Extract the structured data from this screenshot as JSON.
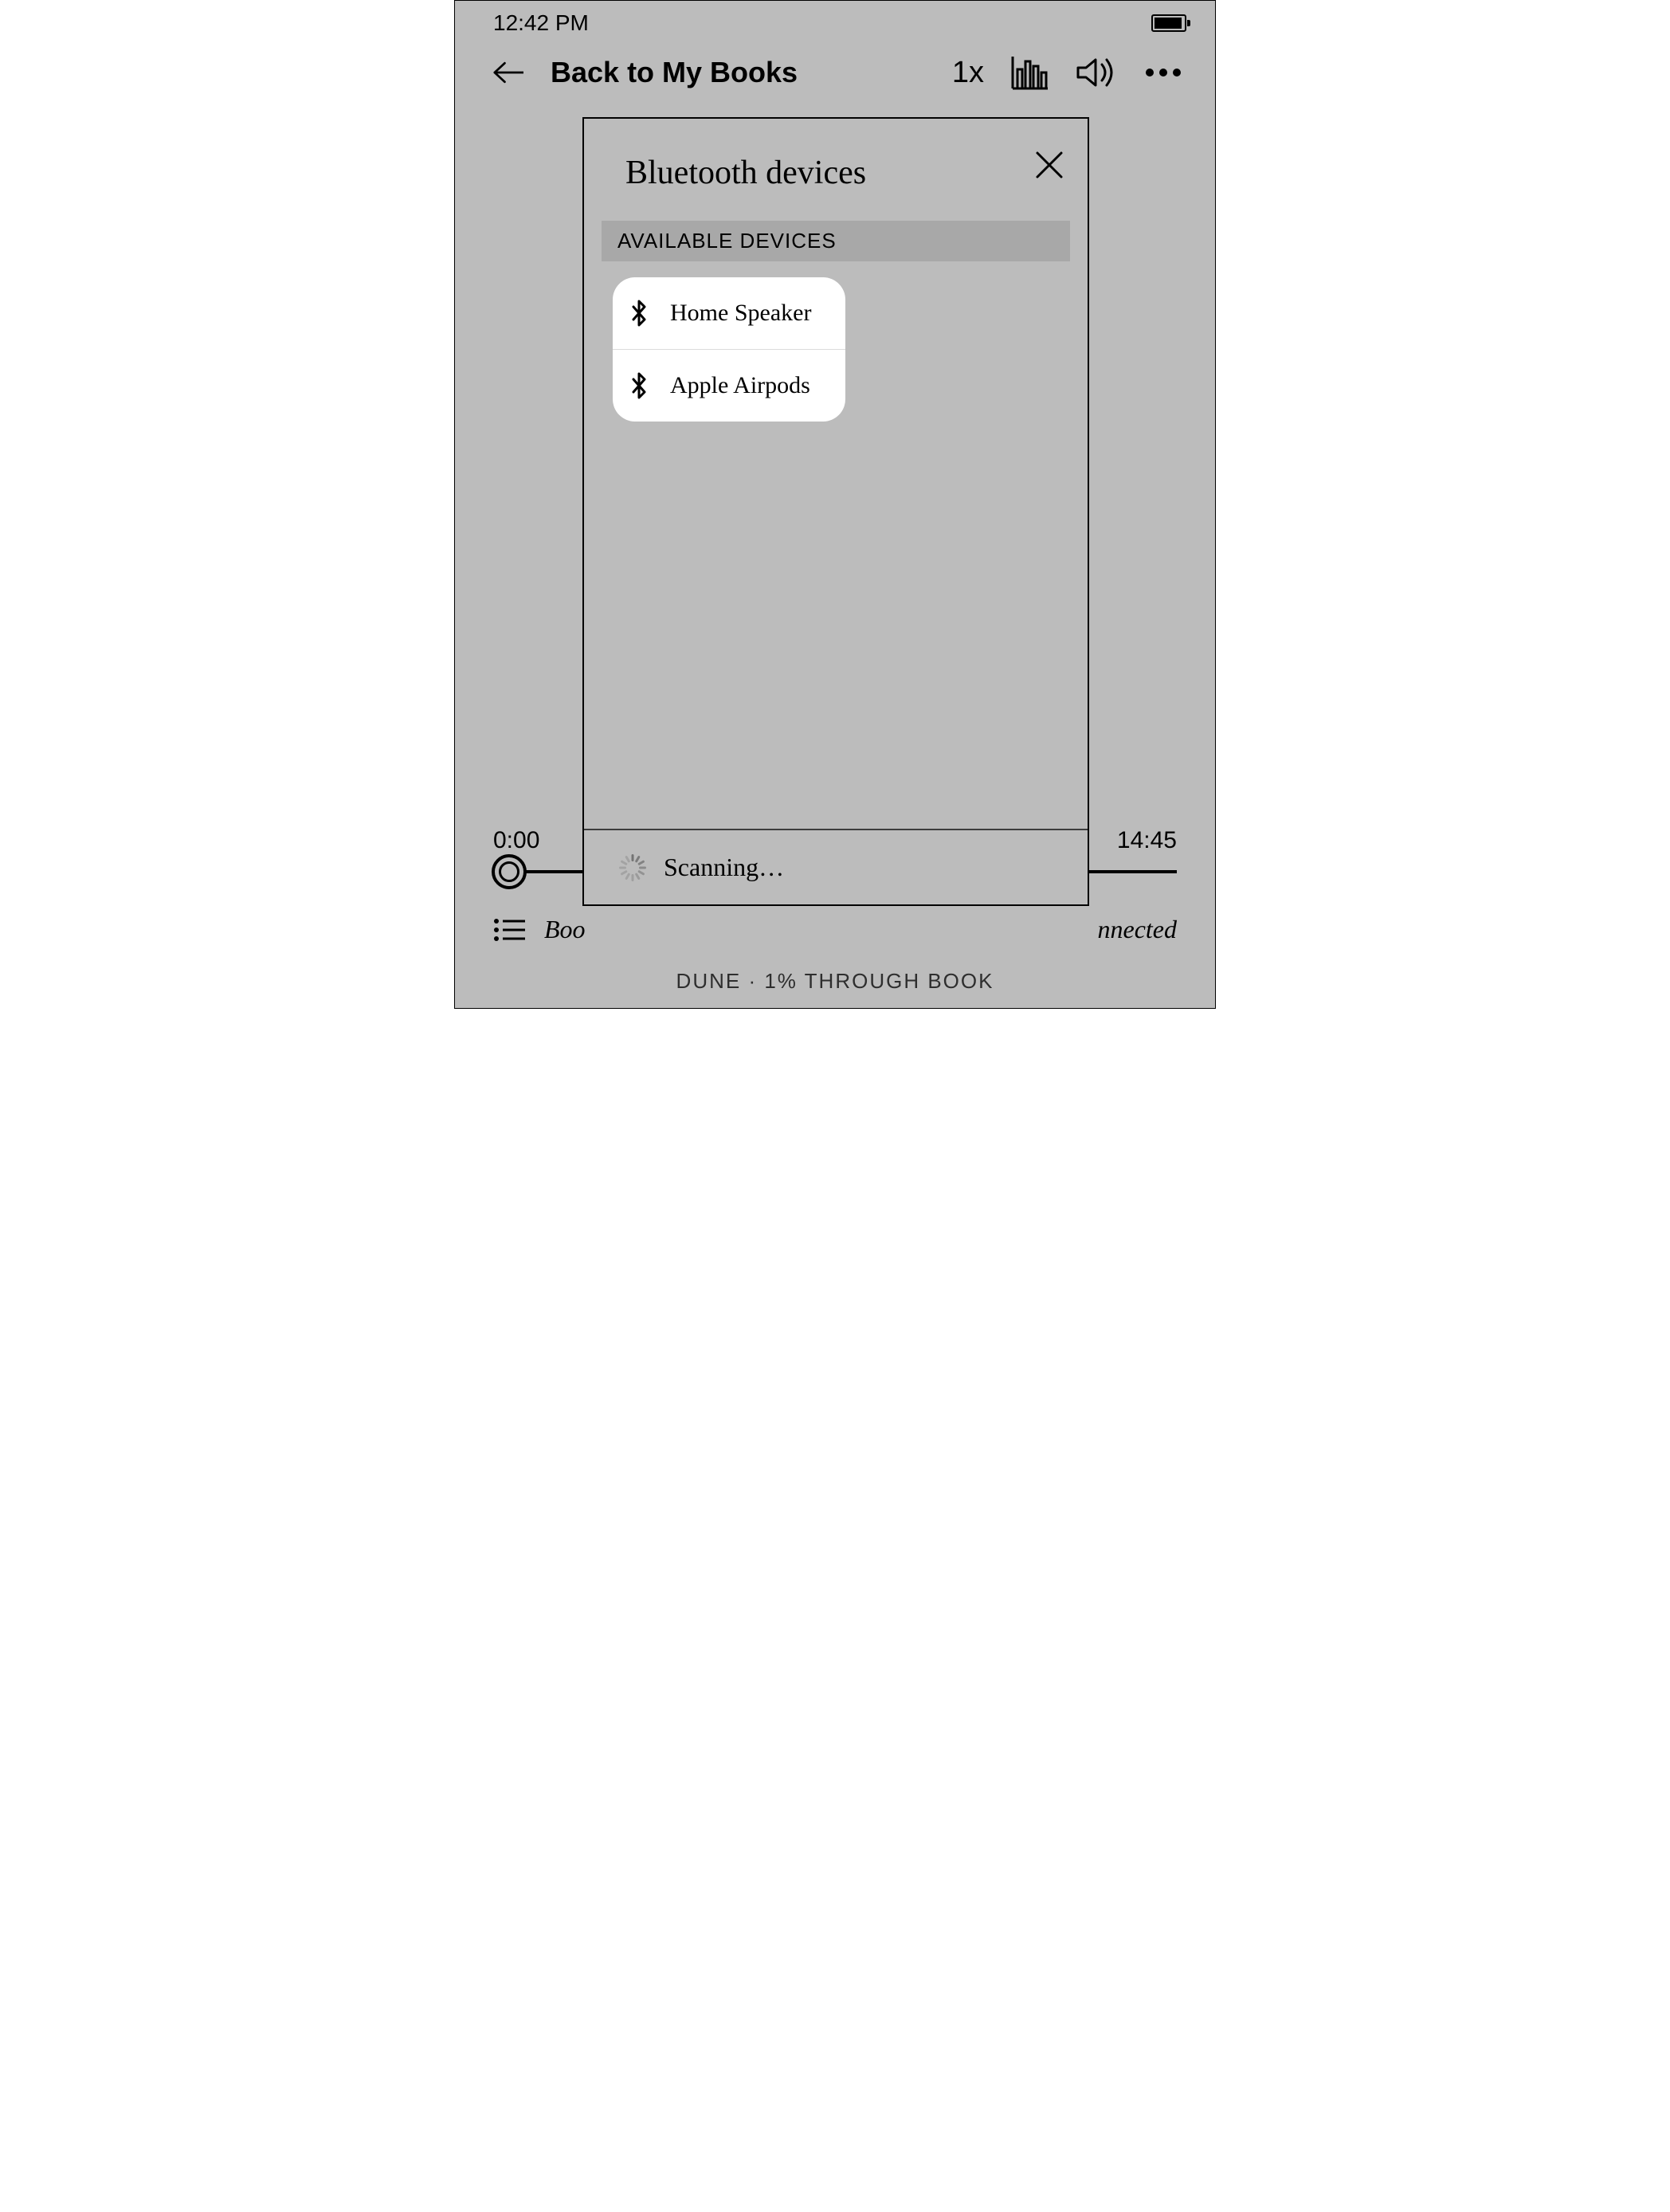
{
  "status": {
    "time": "12:42 PM"
  },
  "toolbar": {
    "back_label": "Back to My Books",
    "speed": "1x"
  },
  "player": {
    "elapsed": "0:00",
    "total": "14:45",
    "left_text": "Boo",
    "right_text": "nnected"
  },
  "footer": {
    "text": "DUNE · 1% THROUGH BOOK"
  },
  "dialog": {
    "title": "Bluetooth devices",
    "section": "AVAILABLE DEVICES",
    "devices": [
      {
        "name": "Home Speaker"
      },
      {
        "name": "Apple Airpods"
      }
    ],
    "status": "Scanning…"
  }
}
